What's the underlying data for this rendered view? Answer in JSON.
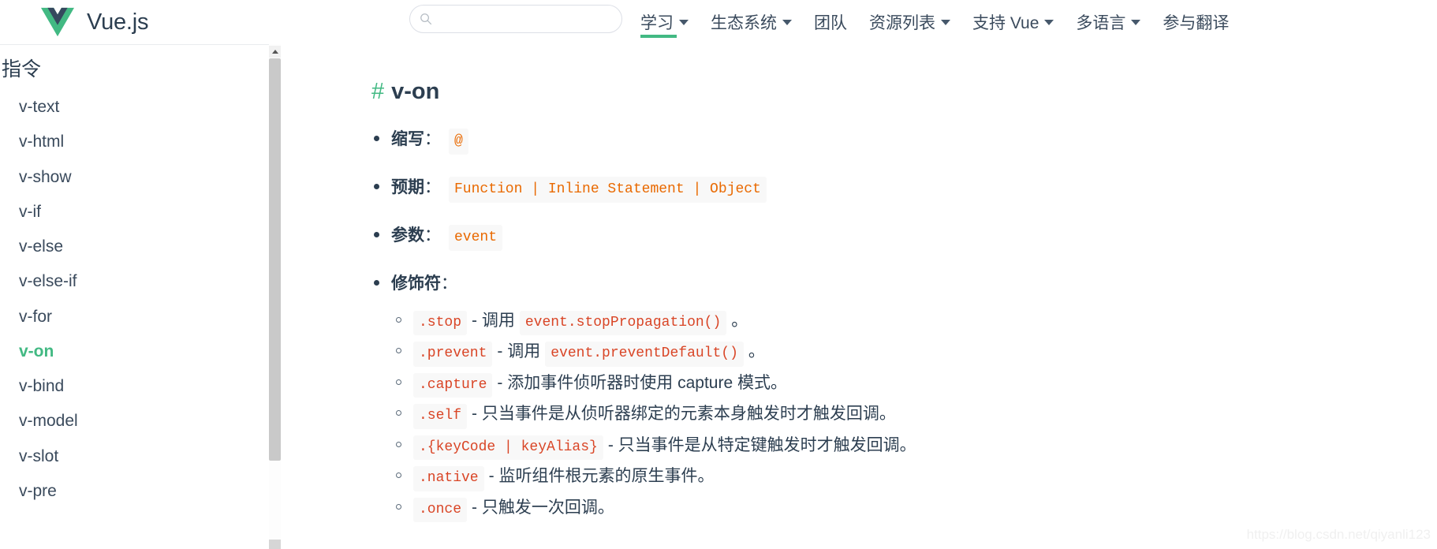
{
  "header": {
    "brand": {
      "name": "Vue.js",
      "logo_icon": "vue-logo-icon"
    },
    "search": {
      "value": "",
      "placeholder": "",
      "icon": "search-icon"
    },
    "nav": [
      {
        "label": "学习",
        "has_caret": true,
        "active": true
      },
      {
        "label": "生态系统",
        "has_caret": true,
        "active": false
      },
      {
        "label": "团队",
        "has_caret": false,
        "active": false
      },
      {
        "label": "资源列表",
        "has_caret": true,
        "active": false
      },
      {
        "label": "支持 Vue",
        "has_caret": true,
        "active": false
      },
      {
        "label": "多语言",
        "has_caret": true,
        "active": false
      },
      {
        "label": "参与翻译",
        "has_caret": false,
        "active": false
      }
    ]
  },
  "sidebar": {
    "group_title": "指令",
    "items": [
      {
        "label": "v-text",
        "active": false
      },
      {
        "label": "v-html",
        "active": false
      },
      {
        "label": "v-show",
        "active": false
      },
      {
        "label": "v-if",
        "active": false
      },
      {
        "label": "v-else",
        "active": false
      },
      {
        "label": "v-else-if",
        "active": false
      },
      {
        "label": "v-for",
        "active": false
      },
      {
        "label": "v-on",
        "active": true
      },
      {
        "label": "v-bind",
        "active": false
      },
      {
        "label": "v-model",
        "active": false
      },
      {
        "label": "v-slot",
        "active": false
      },
      {
        "label": "v-pre",
        "active": false
      }
    ],
    "scrollbar": {
      "up_arrow_icon": "scroll-up-arrow-icon"
    }
  },
  "content": {
    "heading": {
      "anchor": "#",
      "title": "v-on"
    },
    "specs": [
      {
        "label": "缩写",
        "colon": "：",
        "code": "@"
      },
      {
        "label": "预期",
        "colon": "：",
        "code": "Function | Inline Statement | Object"
      },
      {
        "label": "参数",
        "colon": "：",
        "code": "event"
      },
      {
        "label": "修饰符",
        "colon": "：",
        "code": ""
      }
    ],
    "modifiers": [
      {
        "name": ".stop",
        "desc": "- 调用",
        "code": "event.stopPropagation()",
        "tail": "。"
      },
      {
        "name": ".prevent",
        "desc": "- 调用",
        "code": "event.preventDefault()",
        "tail": "。"
      },
      {
        "name": ".capture",
        "desc": "- 添加事件侦听器时使用 capture 模式。",
        "code": "",
        "tail": ""
      },
      {
        "name": ".self",
        "desc": "- 只当事件是从侦听器绑定的元素本身触发时才触发回调。",
        "code": "",
        "tail": ""
      },
      {
        "name": ".{keyCode | keyAlias}",
        "desc": "- 只当事件是从特定键触发时才触发回调。",
        "code": "",
        "tail": ""
      },
      {
        "name": ".native",
        "desc": "- 监听组件根元素的原生事件。",
        "code": "",
        "tail": ""
      },
      {
        "name": ".once",
        "desc": "- 只触发一次回调。",
        "code": "",
        "tail": ""
      }
    ]
  },
  "watermark": "https://blog.csdn.net/qiyanli123",
  "colors": {
    "accent_green": "#42b983",
    "logo_dark": "#35495e",
    "text": "#2c3e50",
    "code_orange": "#e96900",
    "code_red": "#d94526"
  }
}
